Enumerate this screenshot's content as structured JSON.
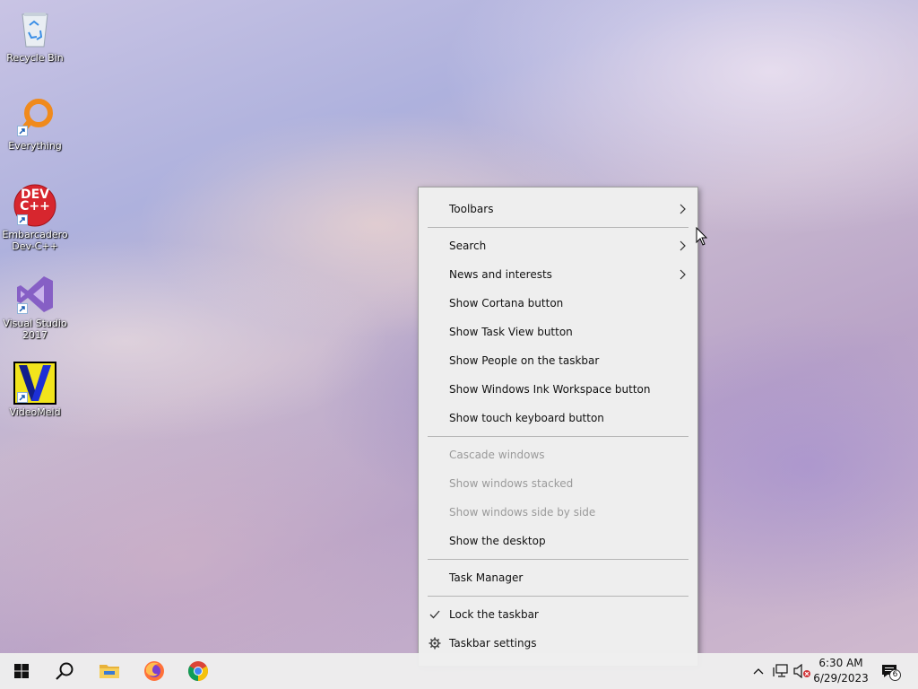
{
  "desktop": {
    "icons": [
      {
        "label": "Recycle Bin"
      },
      {
        "label": "Everything"
      },
      {
        "label": "Embarcadero\nDev-C++"
      },
      {
        "label": "Visual Studio\n2017"
      },
      {
        "label": "VideoMeld"
      }
    ],
    "devcpp_logo_text": "DEV\nC++"
  },
  "context_menu": {
    "items": [
      {
        "label": "Toolbars",
        "submenu": true
      },
      {
        "label": "Search",
        "submenu": true
      },
      {
        "label": "News and interests",
        "submenu": true
      },
      {
        "label": "Show Cortana button"
      },
      {
        "label": "Show Task View button"
      },
      {
        "label": "Show People on the taskbar"
      },
      {
        "label": "Show Windows Ink Workspace button"
      },
      {
        "label": "Show touch keyboard button"
      },
      {
        "label": "Cascade windows",
        "disabled": true
      },
      {
        "label": "Show windows stacked",
        "disabled": true
      },
      {
        "label": "Show windows side by side",
        "disabled": true
      },
      {
        "label": "Show the desktop"
      },
      {
        "label": "Task Manager"
      },
      {
        "label": "Lock the taskbar",
        "checked": true
      },
      {
        "label": "Taskbar settings",
        "icon": "gear-icon"
      }
    ]
  },
  "taskbar": {
    "apps": [
      "start-icon",
      "search-icon",
      "file-explorer-icon",
      "firefox-icon",
      "chrome-icon"
    ],
    "tray": {
      "time": "6:30 AM",
      "date": "6/29/2023",
      "notification_count": "6"
    }
  },
  "colors": {
    "menu_bg": "#eeeeee",
    "taskbar_bg": "#eeeeee",
    "disabled_text": "#9a9a9a"
  }
}
